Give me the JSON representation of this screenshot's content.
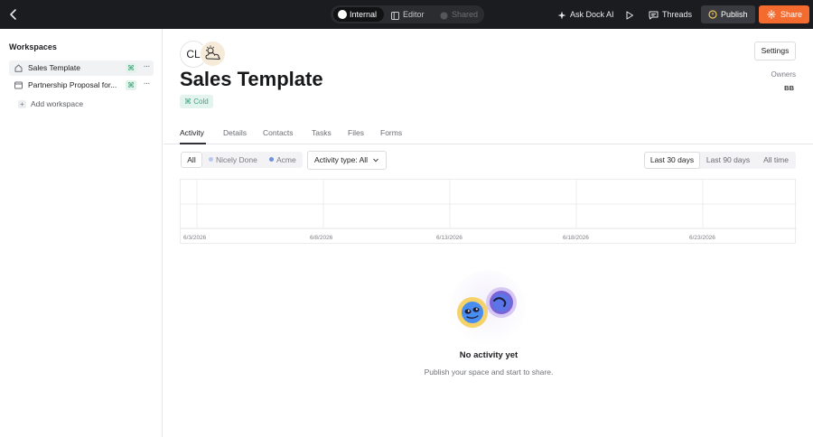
{
  "topbar": {
    "modes": [
      "Internal",
      "Editor",
      "Shared"
    ],
    "active_mode": "Internal",
    "ask_ai_label": "Ask Dock AI",
    "threads_label": "Threads",
    "publish_label": "Publish",
    "share_label": "Share"
  },
  "sidebar": {
    "title": "Workspaces",
    "items": [
      {
        "label": "Sales Template",
        "icon": "home-icon",
        "selected": true
      },
      {
        "label": "Partnership Proposal for...",
        "icon": "window-icon",
        "selected": false
      }
    ],
    "add_label": "Add workspace"
  },
  "page": {
    "avatar_initials": "CL",
    "title": "Sales Template",
    "tag": "Cold",
    "settings_label": "Settings",
    "owners_label": "Owners",
    "owners_value": "BB"
  },
  "tabs": [
    "Activity",
    "Details",
    "Contacts",
    "Tasks",
    "Files",
    "Forms"
  ],
  "active_tab": "Activity",
  "filters": {
    "all_label": "All",
    "chips": [
      {
        "label": "Nicely Done",
        "color": "#b7c7ee"
      },
      {
        "label": "Acme",
        "color": "#6f8fe0"
      }
    ],
    "activity_type_label": "Activity type: All",
    "ranges": [
      "Last 30 days",
      "Last 90 days",
      "All time"
    ],
    "active_range": "Last 30 days"
  },
  "chart_data": {
    "type": "bar",
    "x_ticks": [
      "6/3/2026",
      "6/8/2026",
      "6/13/2026",
      "6/18/2026",
      "6/23/2026"
    ],
    "values": [],
    "grid": true
  },
  "empty_state": {
    "title": "No activity yet",
    "subtitle": "Publish your space and start to share."
  },
  "colors": {
    "topbar_bg": "#1b1c1f",
    "share_accent": "#f36b2f",
    "tag_green": "#3ba57c"
  }
}
